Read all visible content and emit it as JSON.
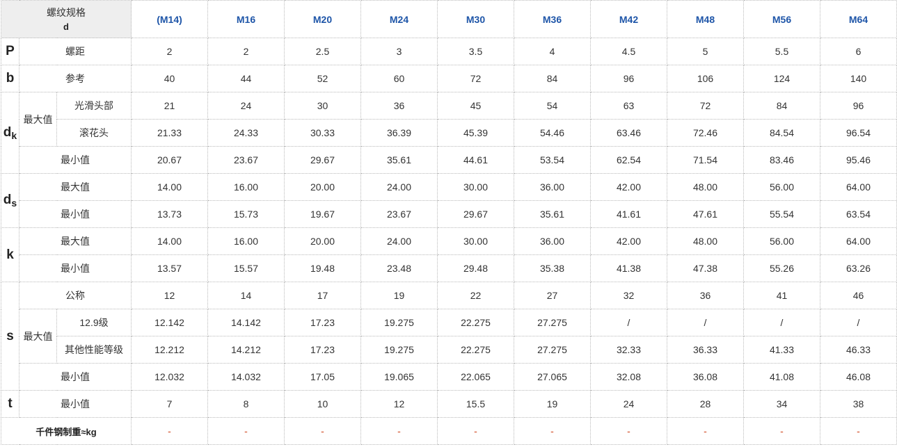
{
  "header": {
    "thread_spec_label": "螺纹规格",
    "thread_spec_symbol": "d",
    "sizes": [
      "(M14)",
      "M16",
      "M20",
      "M24",
      "M30",
      "M36",
      "M42",
      "M48",
      "M56",
      "M64"
    ]
  },
  "symbols": {
    "P": "P",
    "b": "b",
    "d": "d",
    "k_sub": "k",
    "s_sub": "s",
    "k": "k",
    "s": "s",
    "t": "t"
  },
  "labels": {
    "pitch": "螺距",
    "reference": "参考",
    "max": "最大值",
    "min": "最小值",
    "smooth_head": "光滑头部",
    "knurled_head": "滚花头",
    "nominal": "公称",
    "grade_12_9": "12.9级",
    "other_grades": "其他性能等级",
    "weight": "千件钢制重≈kg"
  },
  "rows": {
    "P": [
      "2",
      "2",
      "2.5",
      "3",
      "3.5",
      "4",
      "4.5",
      "5",
      "5.5",
      "6"
    ],
    "b": [
      "40",
      "44",
      "52",
      "60",
      "72",
      "84",
      "96",
      "106",
      "124",
      "140"
    ],
    "dk_max_smooth": [
      "21",
      "24",
      "30",
      "36",
      "45",
      "54",
      "63",
      "72",
      "84",
      "96"
    ],
    "dk_max_knurled": [
      "21.33",
      "24.33",
      "30.33",
      "36.39",
      "45.39",
      "54.46",
      "63.46",
      "72.46",
      "84.54",
      "96.54"
    ],
    "dk_min": [
      "20.67",
      "23.67",
      "29.67",
      "35.61",
      "44.61",
      "53.54",
      "62.54",
      "71.54",
      "83.46",
      "95.46"
    ],
    "ds_max": [
      "14.00",
      "16.00",
      "20.00",
      "24.00",
      "30.00",
      "36.00",
      "42.00",
      "48.00",
      "56.00",
      "64.00"
    ],
    "ds_min": [
      "13.73",
      "15.73",
      "19.67",
      "23.67",
      "29.67",
      "35.61",
      "41.61",
      "47.61",
      "55.54",
      "63.54"
    ],
    "k_max": [
      "14.00",
      "16.00",
      "20.00",
      "24.00",
      "30.00",
      "36.00",
      "42.00",
      "48.00",
      "56.00",
      "64.00"
    ],
    "k_min": [
      "13.57",
      "15.57",
      "19.48",
      "23.48",
      "29.48",
      "35.38",
      "41.38",
      "47.38",
      "55.26",
      "63.26"
    ],
    "s_nominal": [
      "12",
      "14",
      "17",
      "19",
      "22",
      "27",
      "32",
      "36",
      "41",
      "46"
    ],
    "s_max_12_9": [
      "12.142",
      "14.142",
      "17.23",
      "19.275",
      "22.275",
      "27.275",
      "/",
      "/",
      "/",
      "/"
    ],
    "s_max_other": [
      "12.212",
      "14.212",
      "17.23",
      "19.275",
      "22.275",
      "27.275",
      "32.33",
      "36.33",
      "41.33",
      "46.33"
    ],
    "s_min": [
      "12.032",
      "14.032",
      "17.05",
      "19.065",
      "22.065",
      "27.065",
      "32.08",
      "36.08",
      "41.08",
      "46.08"
    ],
    "t_min": [
      "7",
      "8",
      "10",
      "12",
      "15.5",
      "19",
      "24",
      "28",
      "34",
      "38"
    ],
    "weight": [
      "-",
      "-",
      "-",
      "-",
      "-",
      "-",
      "-",
      "-",
      "-",
      "-"
    ]
  },
  "colors": {
    "size_header": "#1e55a8",
    "header_bg": "#eeeeee",
    "dash": "#d0451b",
    "border": "#b9b9b9"
  }
}
